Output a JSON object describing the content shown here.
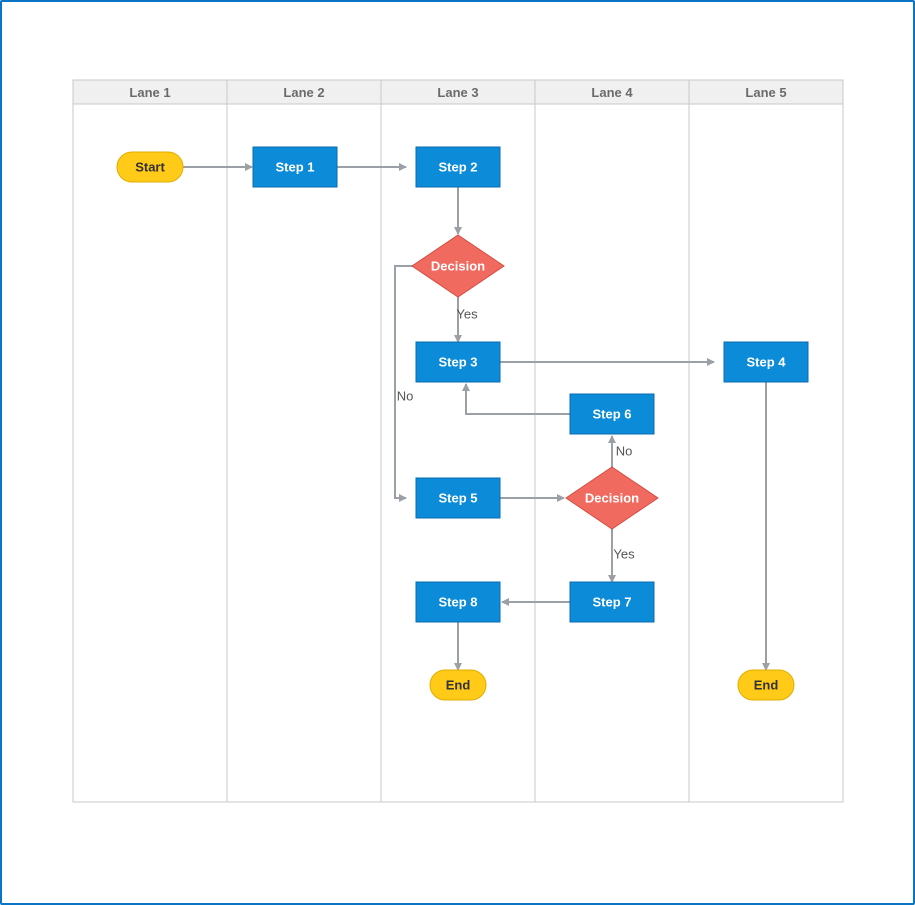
{
  "lanes": {
    "l1": "Lane 1",
    "l2": "Lane 2",
    "l3": "Lane 3",
    "l4": "Lane 4",
    "l5": "Lane 5"
  },
  "nodes": {
    "start": "Start",
    "step1": "Step 1",
    "step2": "Step 2",
    "decision1": "Decision",
    "step3": "Step 3",
    "step4": "Step 4",
    "step5": "Step 5",
    "step6": "Step 6",
    "decision2": "Decision",
    "step7": "Step 7",
    "step8": "Step 8",
    "end1": "End",
    "end2": "End"
  },
  "edges": {
    "yes1": "Yes",
    "no1": "No",
    "yes2": "Yes",
    "no2": "No"
  },
  "chart_data": {
    "type": "flowchart-swimlane",
    "lanes": [
      "Lane 1",
      "Lane 2",
      "Lane 3",
      "Lane 4",
      "Lane 5"
    ],
    "nodes": [
      {
        "id": "start",
        "type": "terminator",
        "lane": "Lane 1",
        "label": "Start"
      },
      {
        "id": "step1",
        "type": "process",
        "lane": "Lane 2",
        "label": "Step 1"
      },
      {
        "id": "step2",
        "type": "process",
        "lane": "Lane 3",
        "label": "Step 2"
      },
      {
        "id": "decision1",
        "type": "decision",
        "lane": "Lane 3",
        "label": "Decision"
      },
      {
        "id": "step3",
        "type": "process",
        "lane": "Lane 3",
        "label": "Step 3"
      },
      {
        "id": "step4",
        "type": "process",
        "lane": "Lane 5",
        "label": "Step 4"
      },
      {
        "id": "step5",
        "type": "process",
        "lane": "Lane 3",
        "label": "Step 5"
      },
      {
        "id": "step6",
        "type": "process",
        "lane": "Lane 4",
        "label": "Step 6"
      },
      {
        "id": "decision2",
        "type": "decision",
        "lane": "Lane 4",
        "label": "Decision"
      },
      {
        "id": "step7",
        "type": "process",
        "lane": "Lane 4",
        "label": "Step 7"
      },
      {
        "id": "step8",
        "type": "process",
        "lane": "Lane 3",
        "label": "Step 8"
      },
      {
        "id": "end1",
        "type": "terminator",
        "lane": "Lane 3",
        "label": "End"
      },
      {
        "id": "end2",
        "type": "terminator",
        "lane": "Lane 5",
        "label": "End"
      }
    ],
    "edges": [
      {
        "from": "start",
        "to": "step1"
      },
      {
        "from": "step1",
        "to": "step2"
      },
      {
        "from": "step2",
        "to": "decision1"
      },
      {
        "from": "decision1",
        "to": "step3",
        "label": "Yes"
      },
      {
        "from": "decision1",
        "to": "step5",
        "label": "No"
      },
      {
        "from": "step3",
        "to": "step4"
      },
      {
        "from": "step4",
        "to": "end2"
      },
      {
        "from": "step5",
        "to": "decision2"
      },
      {
        "from": "decision2",
        "to": "step7",
        "label": "Yes"
      },
      {
        "from": "decision2",
        "to": "step6",
        "label": "No"
      },
      {
        "from": "step6",
        "to": "step3"
      },
      {
        "from": "step7",
        "to": "step8"
      },
      {
        "from": "step8",
        "to": "end1"
      }
    ]
  }
}
